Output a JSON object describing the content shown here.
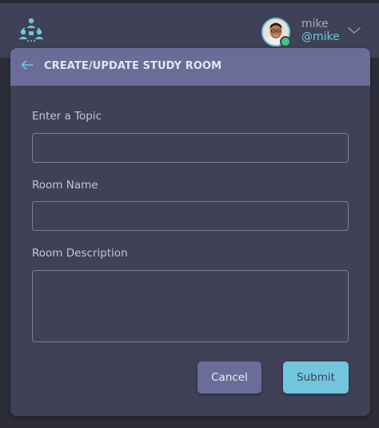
{
  "user": {
    "name": "mike",
    "handle": "@mike",
    "status": "online"
  },
  "icons": {
    "logo": "studybud-logo-icon",
    "chevron": "chevron-down-icon",
    "back": "back-arrow-icon"
  },
  "form": {
    "title": "CREATE/UPDATE STUDY ROOM",
    "fields": [
      {
        "label": "Enter a Topic",
        "value": ""
      },
      {
        "label": "Room Name",
        "value": ""
      },
      {
        "label": "Room Description",
        "value": ""
      }
    ],
    "cancel_label": "Cancel",
    "submit_label": "Submit"
  },
  "colors": {
    "accent": "#71c6dd",
    "header": "#696d97",
    "panel": "#3f4156",
    "background": "#2d2d39"
  }
}
